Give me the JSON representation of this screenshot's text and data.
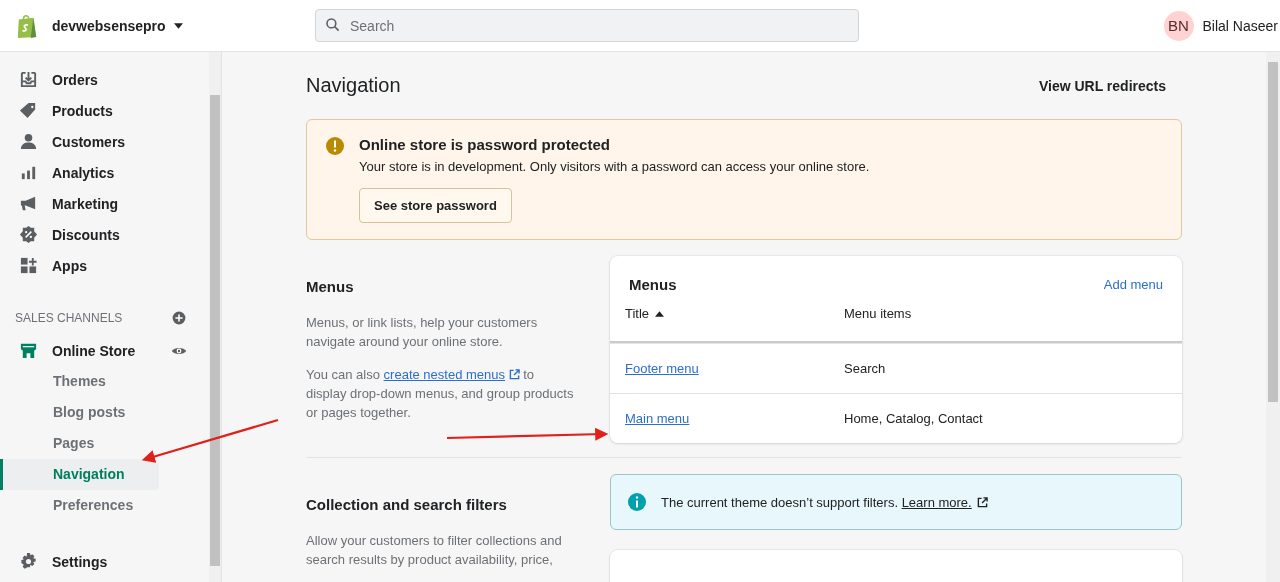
{
  "topbar": {
    "store_name": "devwebsensepro",
    "search": {
      "placeholder": "Search"
    },
    "user": {
      "initials": "BN",
      "name": "Bilal Naseer"
    }
  },
  "sidebar": {
    "items": [
      {
        "label": "Orders"
      },
      {
        "label": "Products"
      },
      {
        "label": "Customers"
      },
      {
        "label": "Analytics"
      },
      {
        "label": "Marketing"
      },
      {
        "label": "Discounts"
      },
      {
        "label": "Apps"
      }
    ],
    "section_title": "SALES CHANNELS",
    "channel": {
      "label": "Online Store"
    },
    "sub_items": [
      {
        "label": "Themes",
        "selected": false
      },
      {
        "label": "Blog posts",
        "selected": false
      },
      {
        "label": "Pages",
        "selected": false
      },
      {
        "label": "Navigation",
        "selected": true
      },
      {
        "label": "Preferences",
        "selected": false
      }
    ],
    "settings": "Settings"
  },
  "page": {
    "title": "Navigation",
    "action": "View URL redirects",
    "banner": {
      "title": "Online store is password protected",
      "text": "Your store is in development. Only visitors with a password can access your online store.",
      "button": "See store password"
    },
    "menus_section": {
      "heading": "Menus",
      "description": "Menus, or link lists, help your customers navigate around your online store.",
      "more_before": "You can also",
      "more_link": "create nested menus",
      "more_after": "to display drop-down menus, and group products or pages together."
    },
    "menus_card": {
      "title": "Menus",
      "action": "Add menu",
      "columns": [
        {
          "label": "Title",
          "sorted": true
        },
        {
          "label": "Menu items",
          "sorted": false
        }
      ],
      "rows": [
        {
          "title": "Footer menu",
          "items": "Search"
        },
        {
          "title": "Main menu",
          "items": "Home, Catalog, Contact"
        }
      ]
    },
    "filters_section": {
      "heading": "Collection and search filters",
      "description": "Allow your customers to filter collections and search results by product availability, price,"
    },
    "info_banner": {
      "text": "The current theme doesn’t support filters.",
      "link": "Learn more."
    }
  }
}
